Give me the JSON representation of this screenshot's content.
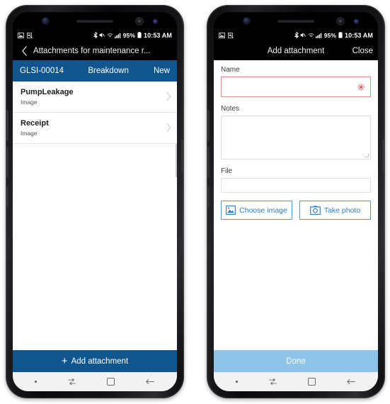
{
  "colors": {
    "brand_blue": "#10558e",
    "disabled_blue": "#8fc4ea",
    "outline_blue": "#4e9bd6",
    "required_red": "#e03b3b"
  },
  "status_bar": {
    "battery_percent": "95%",
    "time": "10:53 AM",
    "icons": [
      "image-icon",
      "screenshot-icon",
      "bluetooth-icon",
      "mute-icon",
      "wifi-icon",
      "signal-icon",
      "battery-icon"
    ]
  },
  "left_phone": {
    "appbar": {
      "back_icon": "chevron-left-icon",
      "title": "Attachments for maintenance r..."
    },
    "record_header": {
      "id": "GLSI-00014",
      "type": "Breakdown",
      "status": "New"
    },
    "attachments": [
      {
        "title": "PumpLeakage",
        "subtitle": "Image",
        "chevron": "chevron-right-icon"
      },
      {
        "title": "Receipt",
        "subtitle": "Image",
        "chevron": "chevron-right-icon"
      }
    ],
    "action_button": {
      "plus": "+",
      "label": "Add attachment"
    }
  },
  "right_phone": {
    "appbar": {
      "title": "Add attachment",
      "close_label": "Close"
    },
    "form": {
      "name_label": "Name",
      "name_value": "",
      "name_required_marker": "✳",
      "notes_label": "Notes",
      "notes_value": "",
      "file_label": "File",
      "file_value": "",
      "choose_image_label": "Choose image",
      "take_photo_label": "Take photo"
    },
    "done_button": {
      "label": "Done"
    }
  },
  "nav_bar": {
    "recents_icon": "recents-icon",
    "home_icon": "home-icon",
    "back_icon": "back-arrow-icon"
  }
}
